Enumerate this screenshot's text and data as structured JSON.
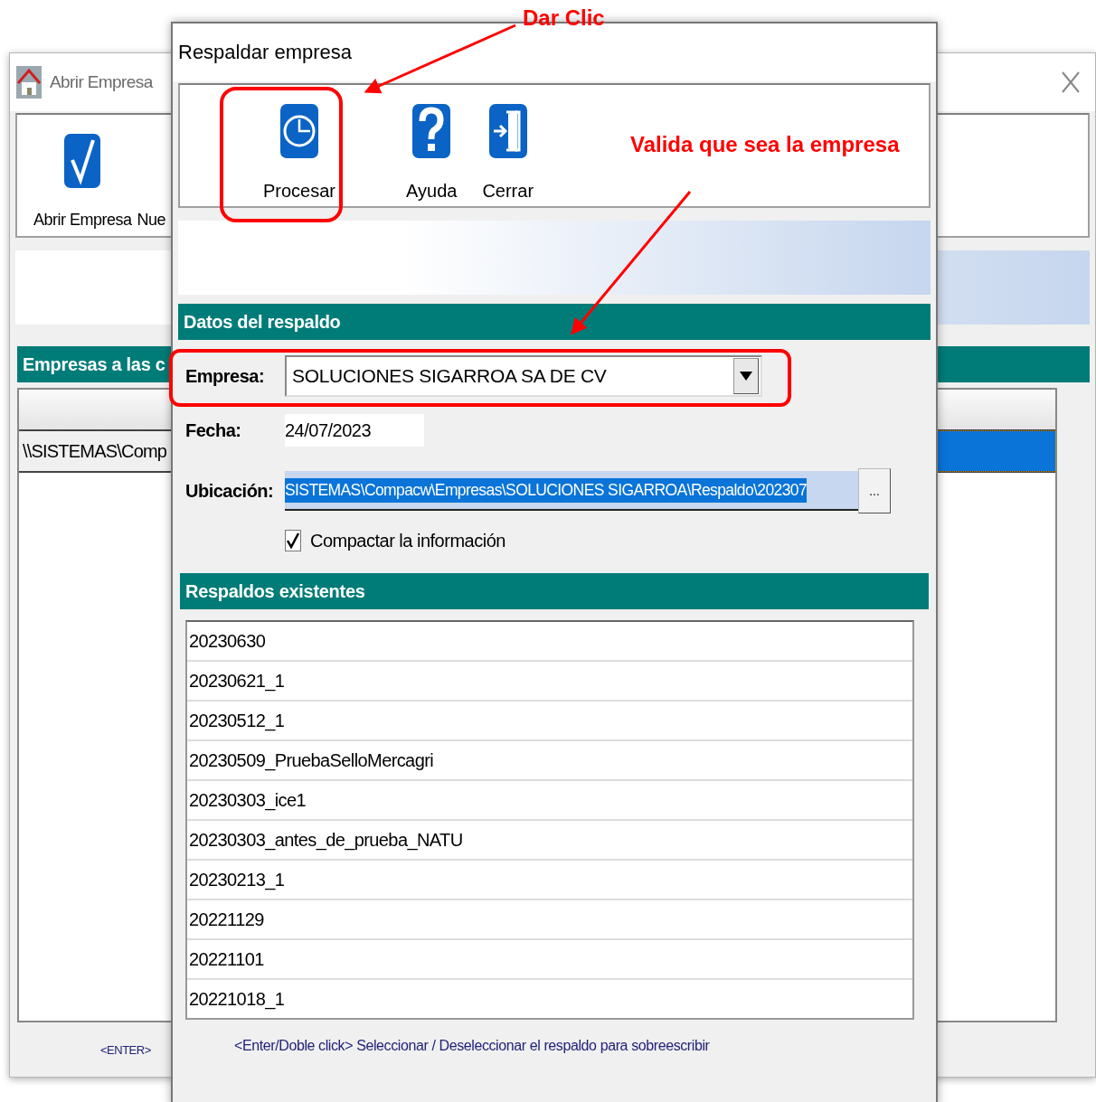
{
  "background_window": {
    "title": "Abrir Empresa",
    "toolbar": [
      {
        "kind": "open",
        "label": "Abrir Empresa"
      },
      {
        "kind": "new",
        "label": "Nue"
      }
    ],
    "section_title": "Empresas a las c",
    "rows": [
      {
        "text": "\\\\SISTEMAS\\Comp",
        "selected": true
      }
    ],
    "footer": "<ENTER>"
  },
  "dialog": {
    "title": "Respaldar empresa",
    "toolbar": [
      {
        "kind": "process",
        "label": "Procesar"
      },
      {
        "kind": "help",
        "label": "Ayuda"
      },
      {
        "kind": "close",
        "label": "Cerrar"
      }
    ],
    "section_data": "Datos del respaldo",
    "empresa": {
      "label": "Empresa:",
      "value": "SOLUCIONES SIGARROA SA DE CV"
    },
    "fecha": {
      "label": "Fecha:",
      "value": "24/07/2023"
    },
    "ubicacion": {
      "label": "Ubicación:",
      "value": "SISTEMAS\\Compacw\\Empresas\\SOLUCIONES SIGARROA\\Respaldo\\202307",
      "button": "..."
    },
    "compactar": {
      "label": "Compactar la información",
      "checked": true
    },
    "section_backups": "Respaldos existentes",
    "backups": [
      "20230630",
      "20230621_1",
      "20230512_1",
      "20230509_PruebaSelloMercagri",
      "20230303_ice1",
      "20230303_antes_de_prueba_NATU",
      "20230213_1",
      "20221129",
      "20221101",
      "20221018_1"
    ],
    "hint": "<Enter/Doble click> Seleccionar / Deseleccionar el respaldo para sobreescribir"
  },
  "annotations": [
    {
      "kind": "click",
      "text": "Dar Clic"
    },
    {
      "kind": "validate",
      "text": "Valida que sea la empresa"
    }
  ]
}
